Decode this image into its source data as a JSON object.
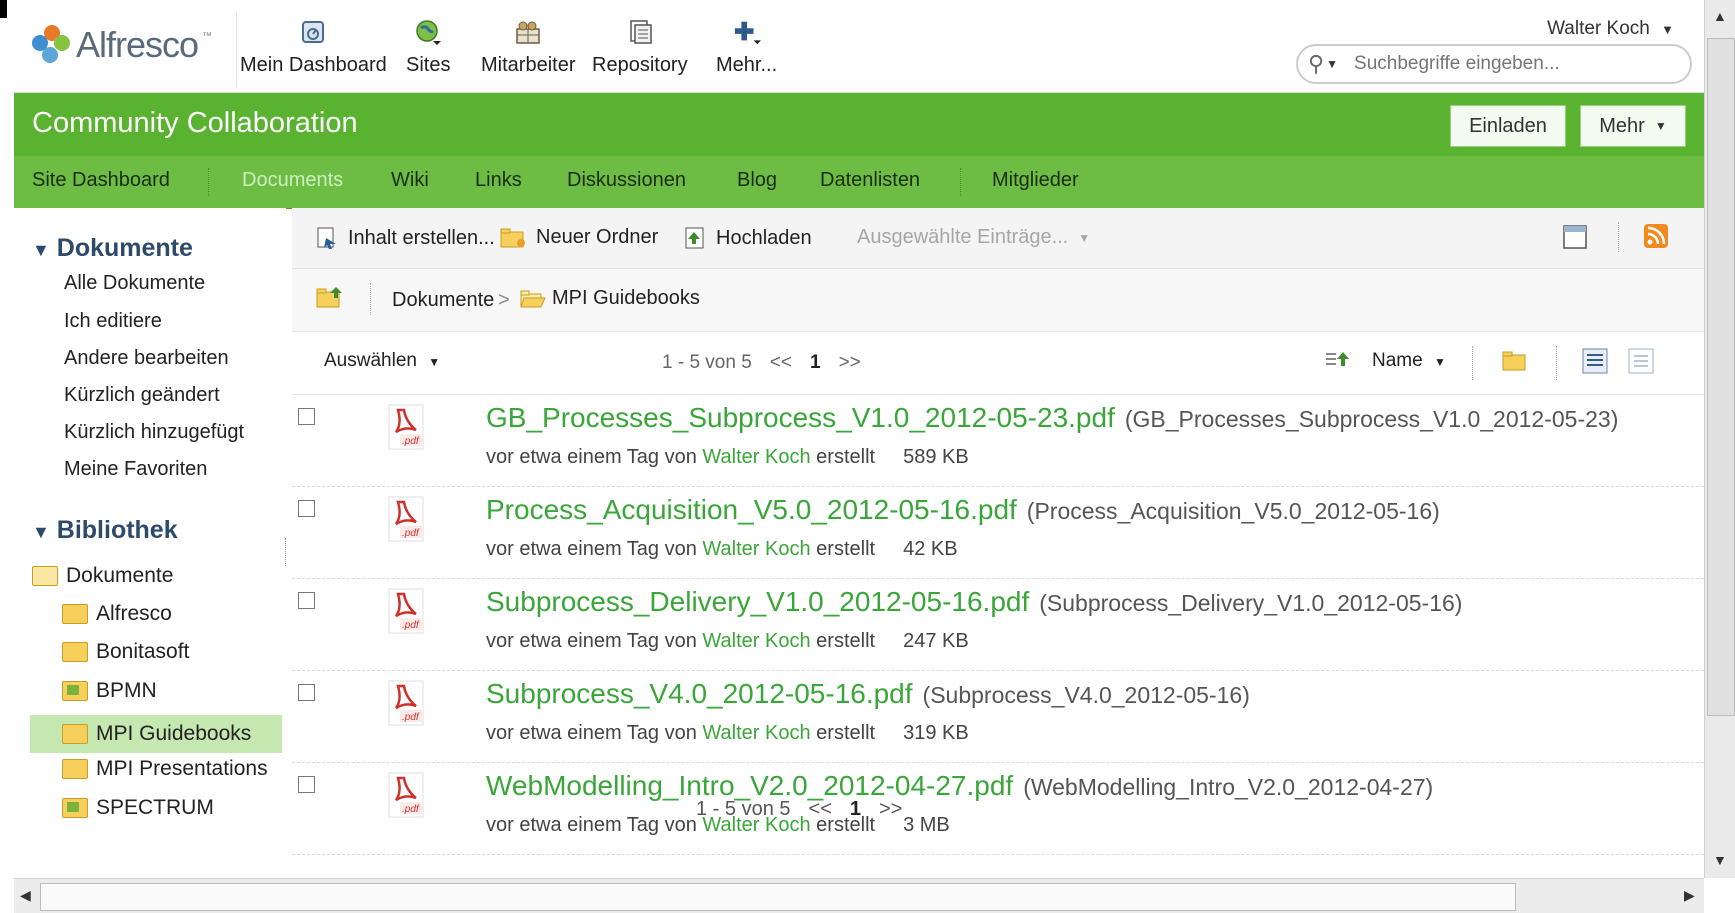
{
  "header": {
    "logo_text": "Alfresco",
    "logo_tm": "™",
    "nav": [
      {
        "label": "Mein Dashboard",
        "icon": "dashboard-icon"
      },
      {
        "label": "Sites",
        "icon": "sites-icon"
      },
      {
        "label": "Mitarbeiter",
        "icon": "people-icon"
      },
      {
        "label": "Repository",
        "icon": "repository-icon"
      },
      {
        "label": "Mehr...",
        "icon": "plus-icon"
      }
    ],
    "user": "Walter Koch",
    "search_placeholder": "Suchbegriffe eingeben..."
  },
  "site": {
    "title": "Community Collaboration",
    "invite_label": "Einladen",
    "more_label": "Mehr"
  },
  "subnav": [
    {
      "label": "Site Dashboard"
    },
    {
      "label": "Documents"
    },
    {
      "label": "Wiki"
    },
    {
      "label": "Links"
    },
    {
      "label": "Diskussionen"
    },
    {
      "label": "Blog"
    },
    {
      "label": "Datenlisten"
    },
    {
      "label": "Mitglieder"
    }
  ],
  "sidebar": {
    "documents_title": "Dokumente",
    "document_filters": [
      "Alle Dokumente",
      "Ich editiere",
      "Andere bearbeiten",
      "Kürzlich geändert",
      "Kürzlich hinzugefügt",
      "Meine Favoriten"
    ],
    "library_title": "Bibliothek",
    "root_folder": "Dokumente",
    "folders": [
      "Alfresco",
      "Bonitasoft",
      "BPMN",
      "MPI Guidebooks",
      "MPI Presentations",
      "SPECTRUM"
    ]
  },
  "toolbar": {
    "create": "Inhalt erstellen...",
    "new_folder": "Neuer Ordner",
    "upload": "Hochladen",
    "selected": "Ausgewählte Einträge..."
  },
  "breadcrumb": {
    "root": "Dokumente",
    "sep": ">",
    "current": "MPI Guidebooks"
  },
  "listbar": {
    "select": "Auswählen",
    "range": "1 - 5 von 5",
    "prev": "<<",
    "page": "1",
    "next": ">>",
    "sort": "Name"
  },
  "meta_labels": {
    "prefix": "vor etwa einem Tag von",
    "suffix": "erstellt"
  },
  "documents": [
    {
      "name": "GB_Processes_Subprocess_V1.0_2012-05-23.pdf",
      "title": "(GB_Processes_Subprocess_V1.0_2012-05-23)",
      "author": "Walter Koch",
      "size": "589 KB"
    },
    {
      "name": "Process_Acquisition_V5.0_2012-05-16.pdf",
      "title": "(Process_Acquisition_V5.0_2012-05-16)",
      "author": "Walter Koch",
      "size": "42 KB"
    },
    {
      "name": "Subprocess_Delivery_V1.0_2012-05-16.pdf",
      "title": "(Subprocess_Delivery_V1.0_2012-05-16)",
      "author": "Walter Koch",
      "size": "247 KB"
    },
    {
      "name": "Subprocess_V4.0_2012-05-16.pdf",
      "title": "(Subprocess_V4.0_2012-05-16)",
      "author": "Walter Koch",
      "size": "319 KB"
    },
    {
      "name": "WebModelling_Intro_V2.0_2012-04-27.pdf",
      "title": "(WebModelling_Intro_V2.0_2012-04-27)",
      "author": "Walter Koch",
      "size": "3 MB"
    }
  ],
  "bottom_pager": {
    "range": "1 - 5 von 5",
    "prev": "<<",
    "page": "1",
    "next": ">>"
  },
  "pdf_badge": ".pdf",
  "colors": {
    "brand_green": "#59b330",
    "subnav_green": "#6dbd45",
    "link_green": "#3aa63a",
    "selected_folder": "#c5e7b0"
  }
}
